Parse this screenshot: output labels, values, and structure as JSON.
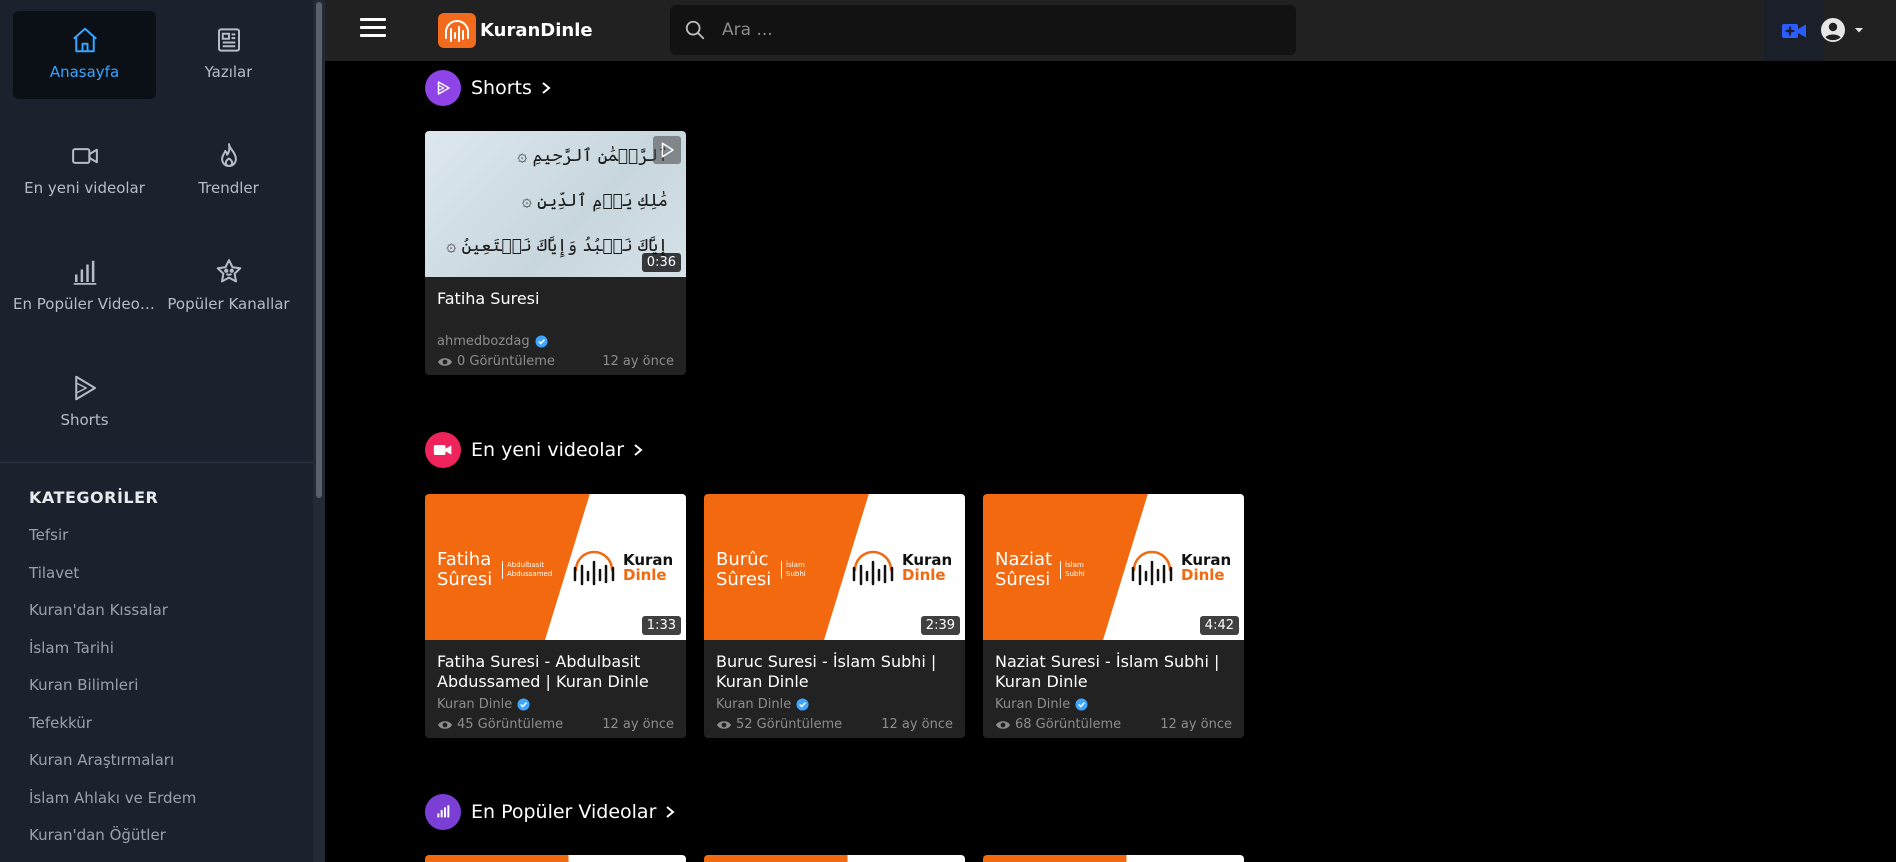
{
  "sidebar": {
    "nav": [
      {
        "label": "Anasayfa",
        "icon": "home-icon",
        "active": true
      },
      {
        "label": "Yazılar",
        "icon": "newspaper-icon",
        "active": false
      },
      {
        "label": "En yeni videolar",
        "icon": "video-camera-icon",
        "active": false
      },
      {
        "label": "Trendler",
        "icon": "flame-icon",
        "active": false
      },
      {
        "label": "En Popüler Videolar",
        "icon": "bar-chart-icon",
        "active": false
      },
      {
        "label": "Popüler Kanallar",
        "icon": "star-badge-icon",
        "active": false
      },
      {
        "label": "Shorts",
        "icon": "shorts-play-icon",
        "active": false
      }
    ],
    "categories_title": "KATEGORİLER",
    "categories": [
      "Tefsir",
      "Tilavet",
      "Kuran'dan Kıssalar",
      "İslam Tarihi",
      "Kuran Bilimleri",
      "Tefekkür",
      "Kuran Araştırmaları",
      "İslam Ahlakı ve Erdem",
      "Kuran'dan Öğütler"
    ]
  },
  "header": {
    "logo_text": "KuranDinle",
    "search_placeholder": "Ara ..."
  },
  "sections": {
    "shorts": {
      "title": "Shorts",
      "cards": [
        {
          "title": "Fatiha Suresi",
          "channel": "ahmedbozdag",
          "views": "0 Görüntüleme",
          "date": "12 ay önce",
          "duration": "0:36",
          "arabic_lines": [
            "ٱلرَّحۡمَٰنِ ٱلرَّحِيمِ ۞",
            "مَٰلِكِ يَوۡمِ ٱلدِّينِ ۞",
            "إِيَّاكَ نَعۡبُدُ وَإِيَّاكَ نَسۡتَعِينُ ۞"
          ]
        }
      ]
    },
    "latest": {
      "title": "En yeni videolar",
      "cards": [
        {
          "title": "Fatiha Suresi - Abdulbasit Abdussamed | Kuran Dinle",
          "channel": "Kuran Dinle",
          "views": "45 Görüntüleme",
          "date": "12 ay önce",
          "duration": "1:33",
          "thumb_surah_1": "Fatiha",
          "thumb_surah_2": "Sûresi",
          "thumb_reciter_1": "Abdulbasit",
          "thumb_reciter_2": "Abdussamed"
        },
        {
          "title": "Buruc Suresi - İslam Subhi | Kuran Dinle",
          "channel": "Kuran Dinle",
          "views": "52 Görüntüleme",
          "date": "12 ay önce",
          "duration": "2:39",
          "thumb_surah_1": "Burûc",
          "thumb_surah_2": "Sûresi",
          "thumb_reciter_1": "İslam",
          "thumb_reciter_2": "Subhi"
        },
        {
          "title": "Naziat Suresi - İslam Subhi | Kuran Dinle",
          "channel": "Kuran Dinle",
          "views": "68 Görüntüleme",
          "date": "12 ay önce",
          "duration": "4:42",
          "thumb_surah_1": "Naziat",
          "thumb_surah_2": "Sûresi",
          "thumb_reciter_1": "İslam",
          "thumb_reciter_2": "Subhi"
        }
      ],
      "thumb_brand_1": "Kuran",
      "thumb_brand_2": "Dinle"
    },
    "popular": {
      "title": "En Popüler Videolar"
    }
  },
  "colors": {
    "accent_blue": "#37a5ff",
    "brand_orange": "#f2690f",
    "shorts_purple": "#8e44e6",
    "latest_pink": "#f0245c",
    "popular_purple": "#7b3fd6",
    "verified_blue": "#3ea6ff",
    "upload_blue": "#2b5cff"
  }
}
